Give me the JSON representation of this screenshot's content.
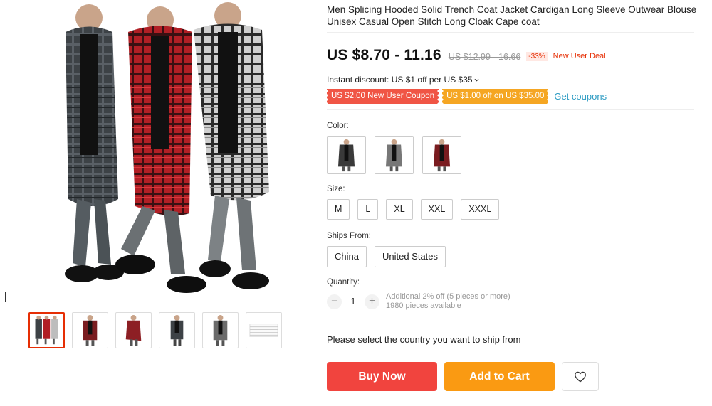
{
  "product": {
    "title": "Men Splicing Hooded Solid Trench Coat Jacket Cardigan Long Sleeve Outwear Blouse Unisex Casual Open Stitch Long Cloak Cape coat",
    "price": "US $8.70 - 11.16",
    "original_price": "US $12.99 - 16.66",
    "discount": "-33%",
    "deal_label": "New User Deal",
    "instant_discount": "Instant discount: US $1 off per US $35"
  },
  "coupons": {
    "items": [
      "US $2.00 New User Coupon",
      "US $1.00 off on US $35.00"
    ],
    "get_label": "Get coupons"
  },
  "colors": {
    "label": "Color:",
    "options": [
      {
        "name": "black",
        "icon": "black-coat-icon",
        "color": "#3a3a3a"
      },
      {
        "name": "grey",
        "icon": "grey-coat-icon",
        "color": "#777777"
      },
      {
        "name": "red",
        "icon": "red-coat-icon",
        "color": "#7a1c20"
      }
    ]
  },
  "size": {
    "label": "Size:",
    "options": [
      "M",
      "L",
      "XL",
      "XXL",
      "XXXL"
    ]
  },
  "ships_from": {
    "label": "Ships From:",
    "options": [
      "China",
      "United States"
    ]
  },
  "quantity": {
    "label": "Quantity:",
    "minus": "−",
    "plus": "+",
    "value": "1",
    "note_discount": "Additional 2% off (5 pieces or more)",
    "note_available": "1980 pieces available"
  },
  "ship_message": "Please select the country you want to ship from",
  "actions": {
    "buy": "Buy Now",
    "cart": "Add to Cart",
    "wishlist_icon": "heart-icon"
  },
  "colors_theme": {
    "primary_red": "#f1443e",
    "orange": "#fa9a12",
    "coupon_red": "#f05545",
    "coupon_orange": "#f5a623",
    "link_blue": "#2e9cc3"
  }
}
